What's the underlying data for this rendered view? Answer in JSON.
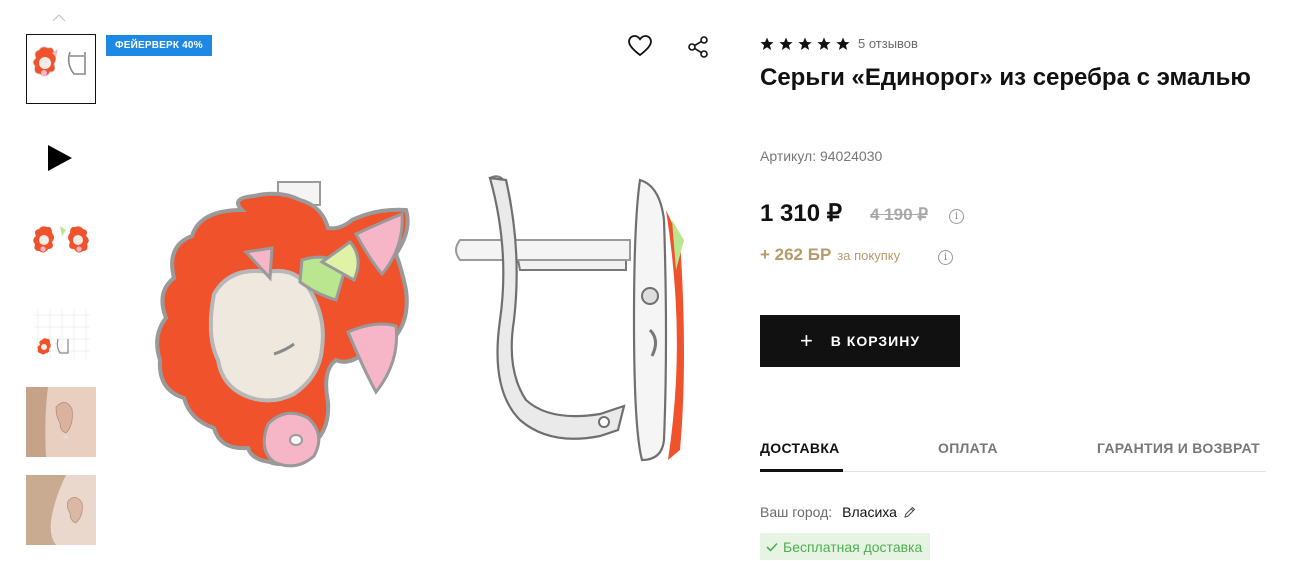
{
  "gallery": {
    "badge": "ФЕЙЕРВЕРК 40%",
    "thumbnails": [
      "earring-pair-front",
      "video",
      "earrings-pair-both",
      "earrings-grid",
      "model-ear-1",
      "model-ear-2"
    ]
  },
  "product": {
    "rating_stars": 5,
    "reviews": "5 отзывов",
    "title": "Серьги «Единорог» из серебра с эмалью",
    "sku": "Артикул: 94024030",
    "price": "1 310 ₽",
    "old_price": "4 190 ₽",
    "bonus_amount": "+ 262 БР",
    "bonus_text": "за покупку"
  },
  "cart": {
    "label": "В КОРЗИНУ"
  },
  "tabs": [
    {
      "label": "ДОСТАВКА",
      "active": true
    },
    {
      "label": "ОПЛАТА",
      "active": false
    },
    {
      "label": "ГАРАНТИЯ И ВОЗВРАТ",
      "active": false
    }
  ],
  "delivery": {
    "city_label": "Ваш город:",
    "city_value": "Власиха",
    "free_delivery": "Бесплатная доставка"
  },
  "colors": {
    "badge": "#1e88e5",
    "accent_gold": "#b69b6a",
    "success": "#4caf50",
    "enamel_orange": "#f0522b",
    "enamel_pink": "#f7b6c7",
    "enamel_green": "#b9e68f"
  }
}
